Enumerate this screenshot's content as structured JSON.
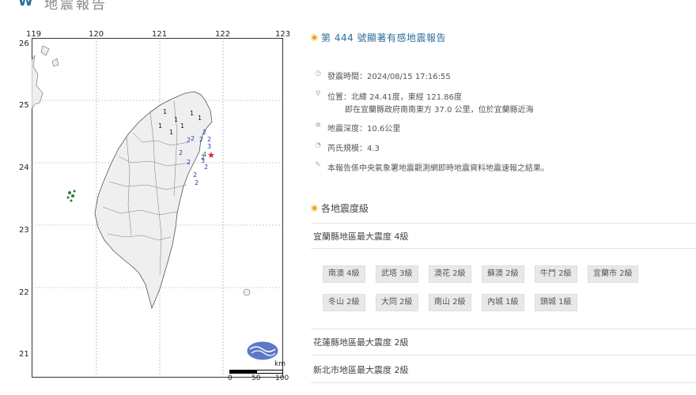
{
  "header": {
    "logo_glyph": "₩",
    "heading": "地震報告"
  },
  "map": {
    "lon_ticks": [
      "119",
      "120",
      "121",
      "122",
      "123"
    ],
    "lat_ticks": [
      "26",
      "25",
      "24",
      "23",
      "22",
      "21"
    ],
    "scale": {
      "unit": "km",
      "ticks": [
        "0",
        "50",
        "100"
      ]
    },
    "epicenter_color": "#e02020",
    "land_fill": "#efefef",
    "intensity_labels": [
      "1",
      "1",
      "1",
      "1",
      "1",
      "1",
      "1",
      "2",
      "2",
      "2",
      "2",
      "2",
      "3",
      "2",
      "2",
      "2",
      "2",
      "2",
      "2",
      "4",
      "3"
    ]
  },
  "report": {
    "title": "第 444 號顯著有感地震報告",
    "time": "發震時間：2024/08/15 17:16:55",
    "location": "位置：北緯 24.41度，東經 121.86度",
    "location_detail": "即在宜蘭縣政府南南東方 37.0 公里，位於宜蘭縣近海",
    "depth": "地震深度：10.6公里",
    "magnitude": "芮氏規模：4.3",
    "note": "本報告係中央氣象署地震觀測網即時地震資料地震速報之結果。",
    "accent_color": "#f0a020"
  },
  "intensity": {
    "section_title": "各地震度級",
    "counties": [
      {
        "heading": "宜蘭縣地區最大震度 4級",
        "stations": [
          "南澳 4級",
          "武塔 3級",
          "澳花 2級",
          "蘇澳 2級",
          "牛鬥 2級",
          "宜蘭市 2級",
          "冬山 2級",
          "大同 2級",
          "南山 2級",
          "內城 1級",
          "頭城 1級"
        ]
      },
      {
        "heading": "花蓮縣地區最大震度 2級"
      },
      {
        "heading": "新北市地區最大震度 2級"
      }
    ]
  }
}
